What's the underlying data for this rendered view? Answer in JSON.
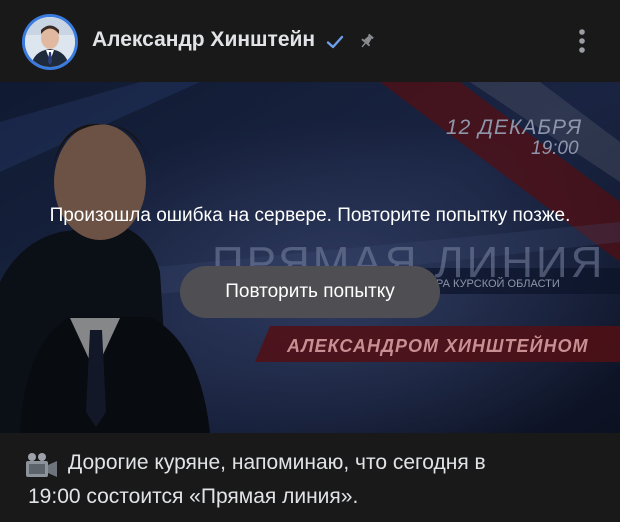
{
  "post": {
    "author_name": "Александр Хинштейн",
    "verified_icon": "verified-check-icon",
    "pin_icon": "pin-icon",
    "more_icon": "more-vertical-icon",
    "text_line1": "Дорогие куряне, напоминаю, что сегодня в",
    "text_line2": "19:00 состоится «Прямая линия».",
    "emoji_icon": "movie-camera-icon"
  },
  "video": {
    "date_line": "12 ДЕКАБРЯ",
    "time_line": "19:00",
    "title": "ПРЯМАЯ ЛИНИЯ",
    "subtitle": "ГУБЕРНАТОРА КУРСКОЙ ОБЛАСТИ",
    "host_line": "АЛЕКСАНДРОМ ХИНШТЕЙНОМ",
    "error_message": "Произошла ошибка на сервере. Повторите попытку позже.",
    "retry_label": "Повторить попытку"
  },
  "colors": {
    "background": "#19191a",
    "text": "#e1e3e6",
    "accent": "#3a7be0",
    "button": "#4f4f53",
    "banner_red": "#8e1a22"
  }
}
